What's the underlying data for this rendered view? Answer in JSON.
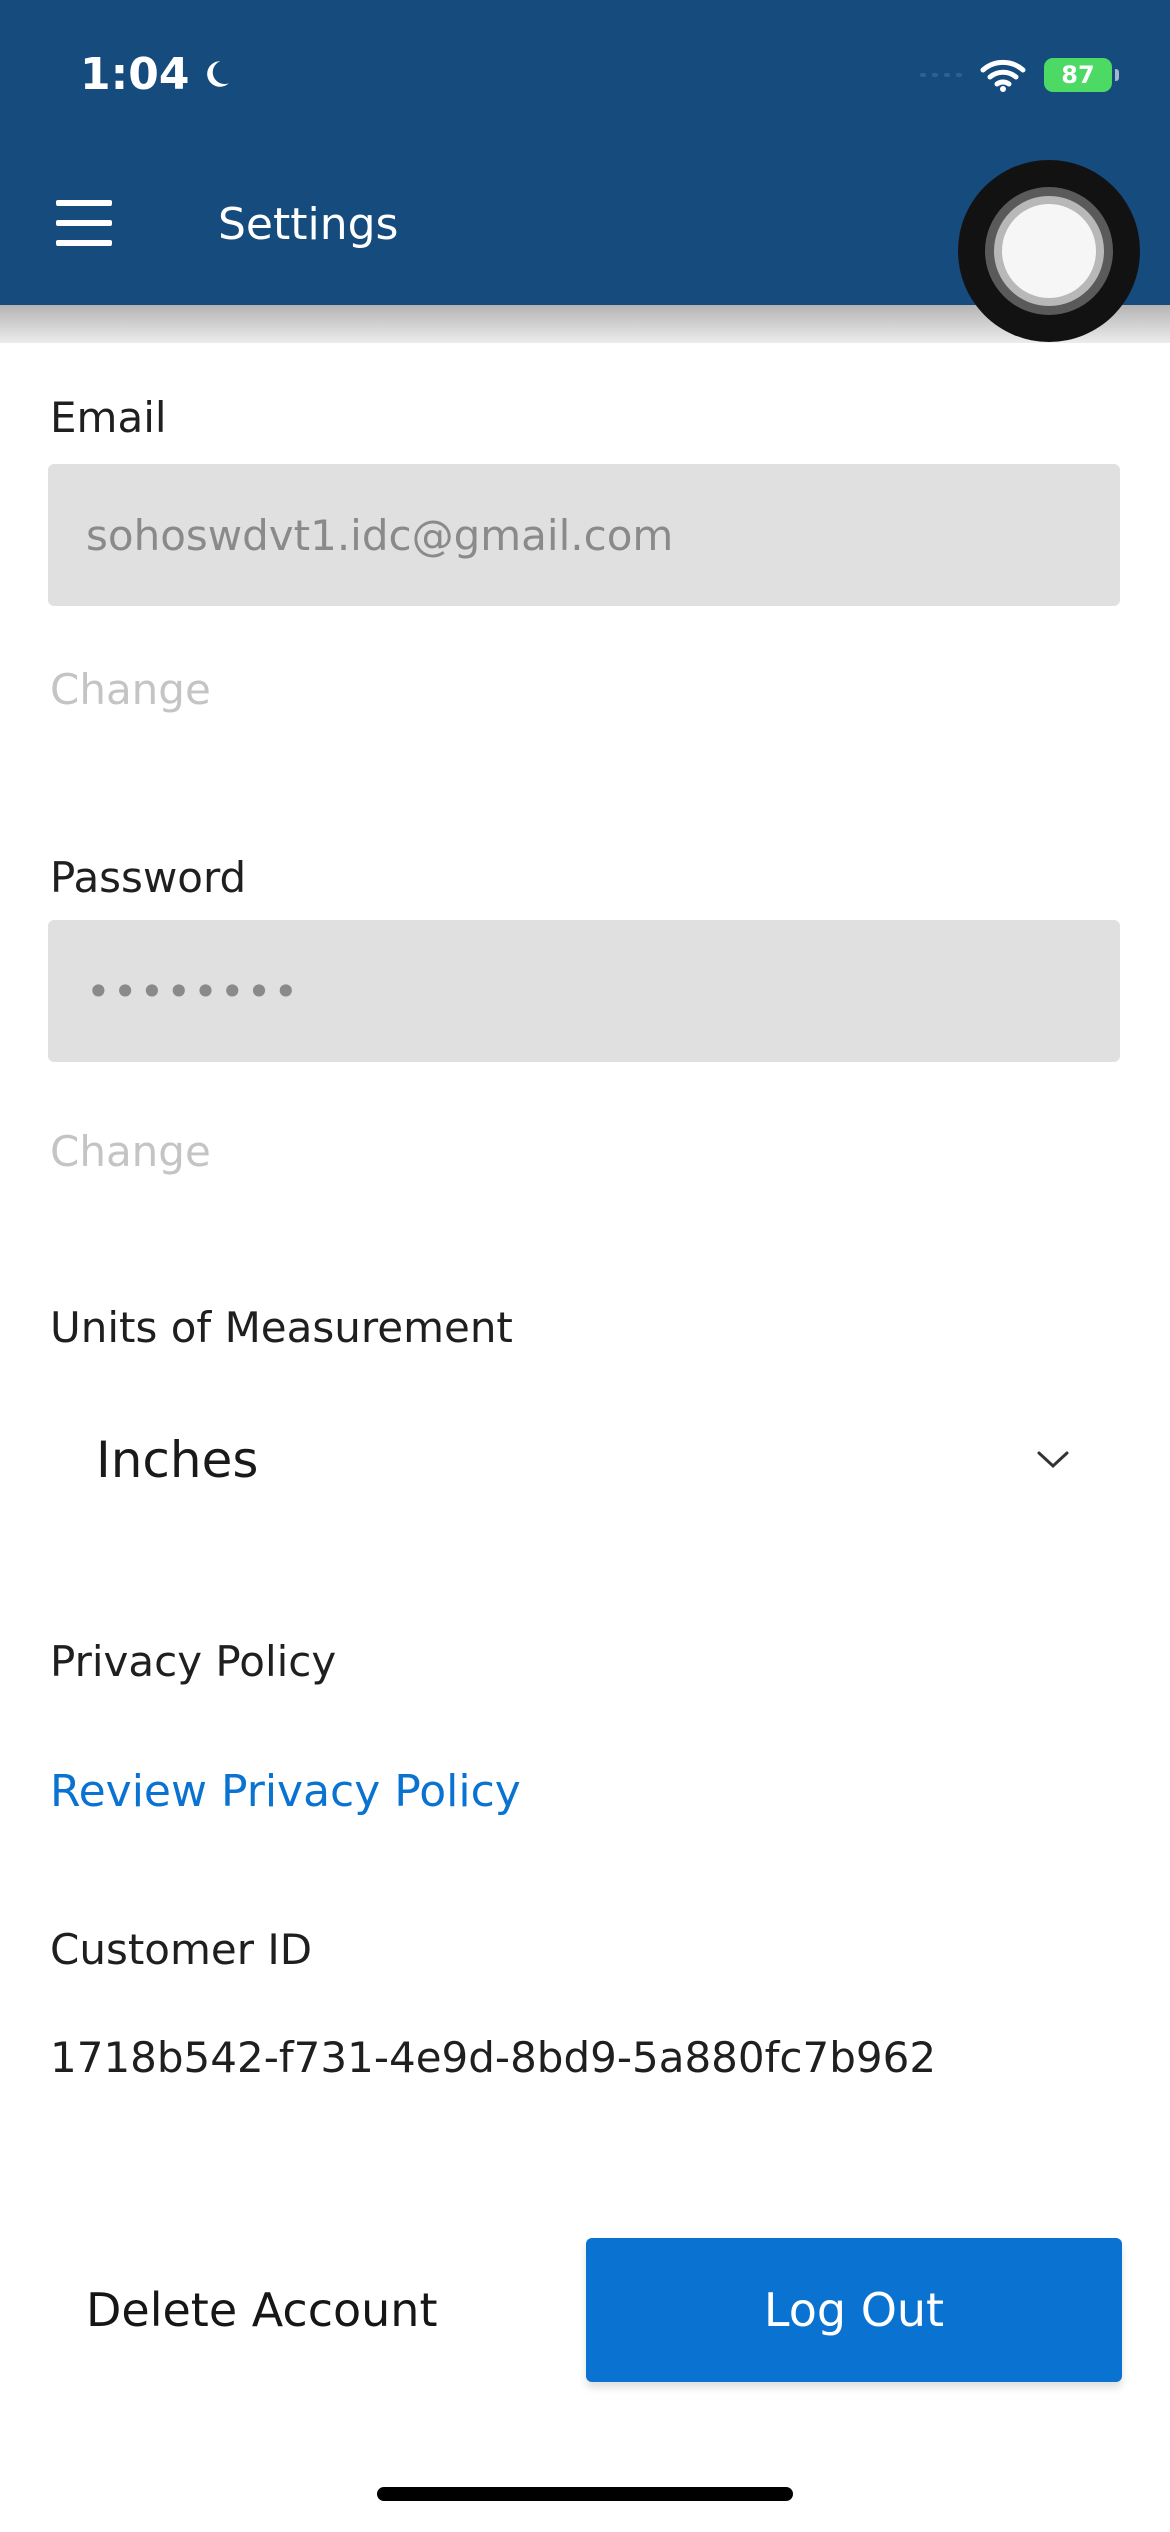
{
  "status_bar": {
    "time": "1:04",
    "battery": "87"
  },
  "header": {
    "title": "Settings"
  },
  "email": {
    "label": "Email",
    "value": "sohoswdvt1.idc@gmail.com",
    "change_label": "Change"
  },
  "password": {
    "label": "Password",
    "value": "••••••••",
    "change_label": "Change"
  },
  "units": {
    "label": "Units of Measurement",
    "selected": "Inches"
  },
  "privacy": {
    "label": "Privacy Policy",
    "link": "Review Privacy Policy"
  },
  "customer": {
    "label": "Customer ID",
    "value": "1718b542-f731-4e9d-8bd9-5a880fc7b962"
  },
  "actions": {
    "delete_label": "Delete Account",
    "logout_label": "Log Out"
  },
  "colors": {
    "header": "#154b7d",
    "accent": "#0a73d2",
    "battery": "#4cd964"
  }
}
